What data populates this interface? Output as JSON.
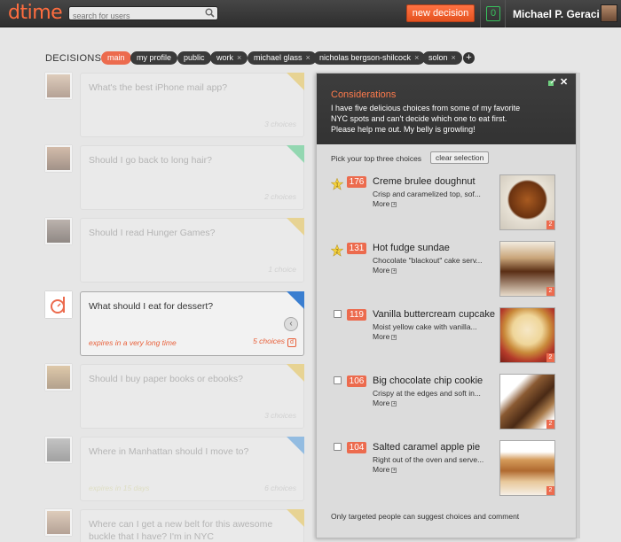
{
  "app": {
    "logo": "dtime",
    "search_placeholder": "search for users",
    "new_decision": "new decision",
    "notification_count": "0",
    "username": "Michael P. Geraci"
  },
  "filters": {
    "label": "DECISIONS:",
    "chips": [
      "main",
      "my profile",
      "public",
      "work",
      "michael glass",
      "nicholas bergson-shilcock",
      "solon"
    ],
    "remove_glyph": "×",
    "add_glyph": "+"
  },
  "decisions": [
    {
      "question": "What's the best iPhone mail app?",
      "count": "3 choices",
      "expires": "",
      "corner_color": "#e8cf7f"
    },
    {
      "question": "Should I go back to long hair?",
      "count": "2 choices",
      "expires": "",
      "corner_color": "#7fd4a5"
    },
    {
      "question": "Should I read Hunger Games?",
      "count": "1 choice",
      "expires": "",
      "corner_color": "#e8cf7f"
    },
    {
      "question": "What should I eat for dessert?",
      "count": "5 choices",
      "expires": "expires in a very long time",
      "corner_color": "#3a7ed0",
      "active": true
    },
    {
      "question": "Should I buy paper books or ebooks?",
      "count": "3 choices",
      "expires": "",
      "corner_color": "#e8cf7f"
    },
    {
      "question": "Where in Manhattan should I move to?",
      "count": "6 choices",
      "expires": "expires in 15 days",
      "corner_color": "#7fb2e0"
    },
    {
      "question": "Where can I get a new belt for this awesome buckle that I have? I'm in NYC",
      "count": "",
      "expires": "",
      "corner_color": "#e8cf7f"
    }
  ],
  "active_tag": "d",
  "collapse_glyph": "‹",
  "panel": {
    "title": "Considerations",
    "description": "I have five delicious choices from some of my favorite NYC spots and can't decide which one to eat first. Please help me out. My belly is growling!",
    "close_glyph": "✕",
    "pick_label": "Pick your top three choices",
    "clear_button": "clear selection",
    "footer": "Only targeted people can suggest choices and comment",
    "choices": [
      {
        "votes": "176",
        "name": "Creme brulee doughnut",
        "desc": "Crisp and caramelized top, sof...",
        "more": "More",
        "image_count": "2",
        "rank": "1",
        "selected": true
      },
      {
        "votes": "131",
        "name": "Hot fudge sundae",
        "desc": "Chocolate \"blackout\" cake serv...",
        "more": "More",
        "image_count": "2",
        "rank": "2",
        "selected": true
      },
      {
        "votes": "119",
        "name": "Vanilla buttercream cupcake",
        "desc": "Moist yellow cake with vanilla...",
        "more": "More",
        "image_count": "2",
        "rank": "",
        "selected": false
      },
      {
        "votes": "106",
        "name": "Big chocolate chip cookie",
        "desc": "Crispy at the edges and soft in...",
        "more": "More",
        "image_count": "2",
        "rank": "",
        "selected": false
      },
      {
        "votes": "104",
        "name": "Salted caramel apple pie",
        "desc": "Right out of the oven and serve...",
        "more": "More",
        "image_count": "2",
        "rank": "",
        "selected": false
      }
    ]
  },
  "colors": {
    "accent": "#ec6b4e",
    "topbar": "#3a3a3a",
    "counter_green": "#37c15c"
  }
}
